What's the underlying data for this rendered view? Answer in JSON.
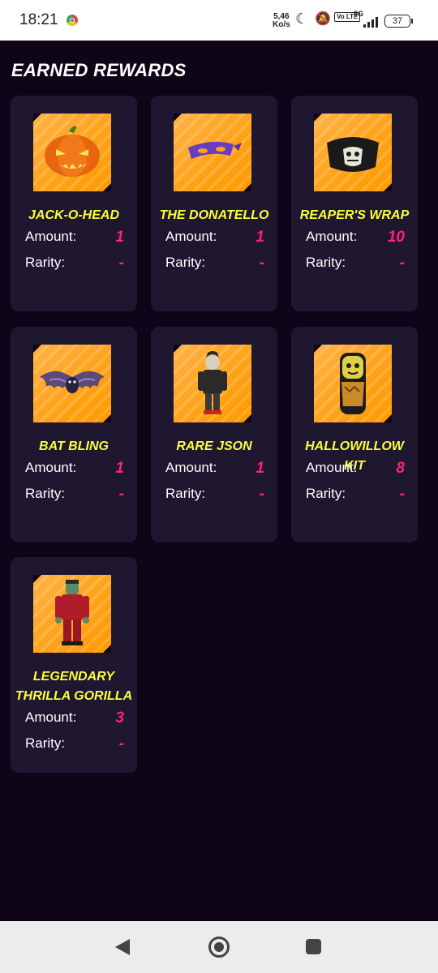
{
  "status_bar": {
    "time": "18:21",
    "net_speed": "5,46",
    "net_unit": "Ko/s",
    "volte": "Vo LTE",
    "network": "5G",
    "battery": "37"
  },
  "section_title": "EARNED REWARDS",
  "labels": {
    "amount": "Amount:",
    "rarity": "Rarity:"
  },
  "rewards": [
    {
      "name": "JACK-O-HEAD",
      "amount": "1",
      "rarity": "-",
      "icon": "pumpkin-icon"
    },
    {
      "name": "THE DONATELLO",
      "amount": "1",
      "rarity": "-",
      "icon": "purple-mask-icon"
    },
    {
      "name": "REAPER'S WRAP",
      "amount": "10",
      "rarity": "-",
      "icon": "skull-wrap-icon"
    },
    {
      "name": "BAT BLING",
      "amount": "1",
      "rarity": "-",
      "icon": "bat-icon"
    },
    {
      "name": "RARE JSON",
      "amount": "1",
      "rarity": "-",
      "icon": "character-json-icon"
    },
    {
      "name": "HALLOWILLOW KIT",
      "amount": "8",
      "rarity": "-",
      "icon": "hallowillow-icon"
    },
    {
      "name": "LEGENDARY THRILLA GORILLA",
      "amount": "3",
      "rarity": "-",
      "icon": "thrilla-gorilla-icon"
    }
  ],
  "colors": {
    "background": "#0e0618",
    "card": "#1f1730",
    "name": "#f7ff3c",
    "value": "#ff1f82",
    "image_bg": "#ffa31a"
  }
}
